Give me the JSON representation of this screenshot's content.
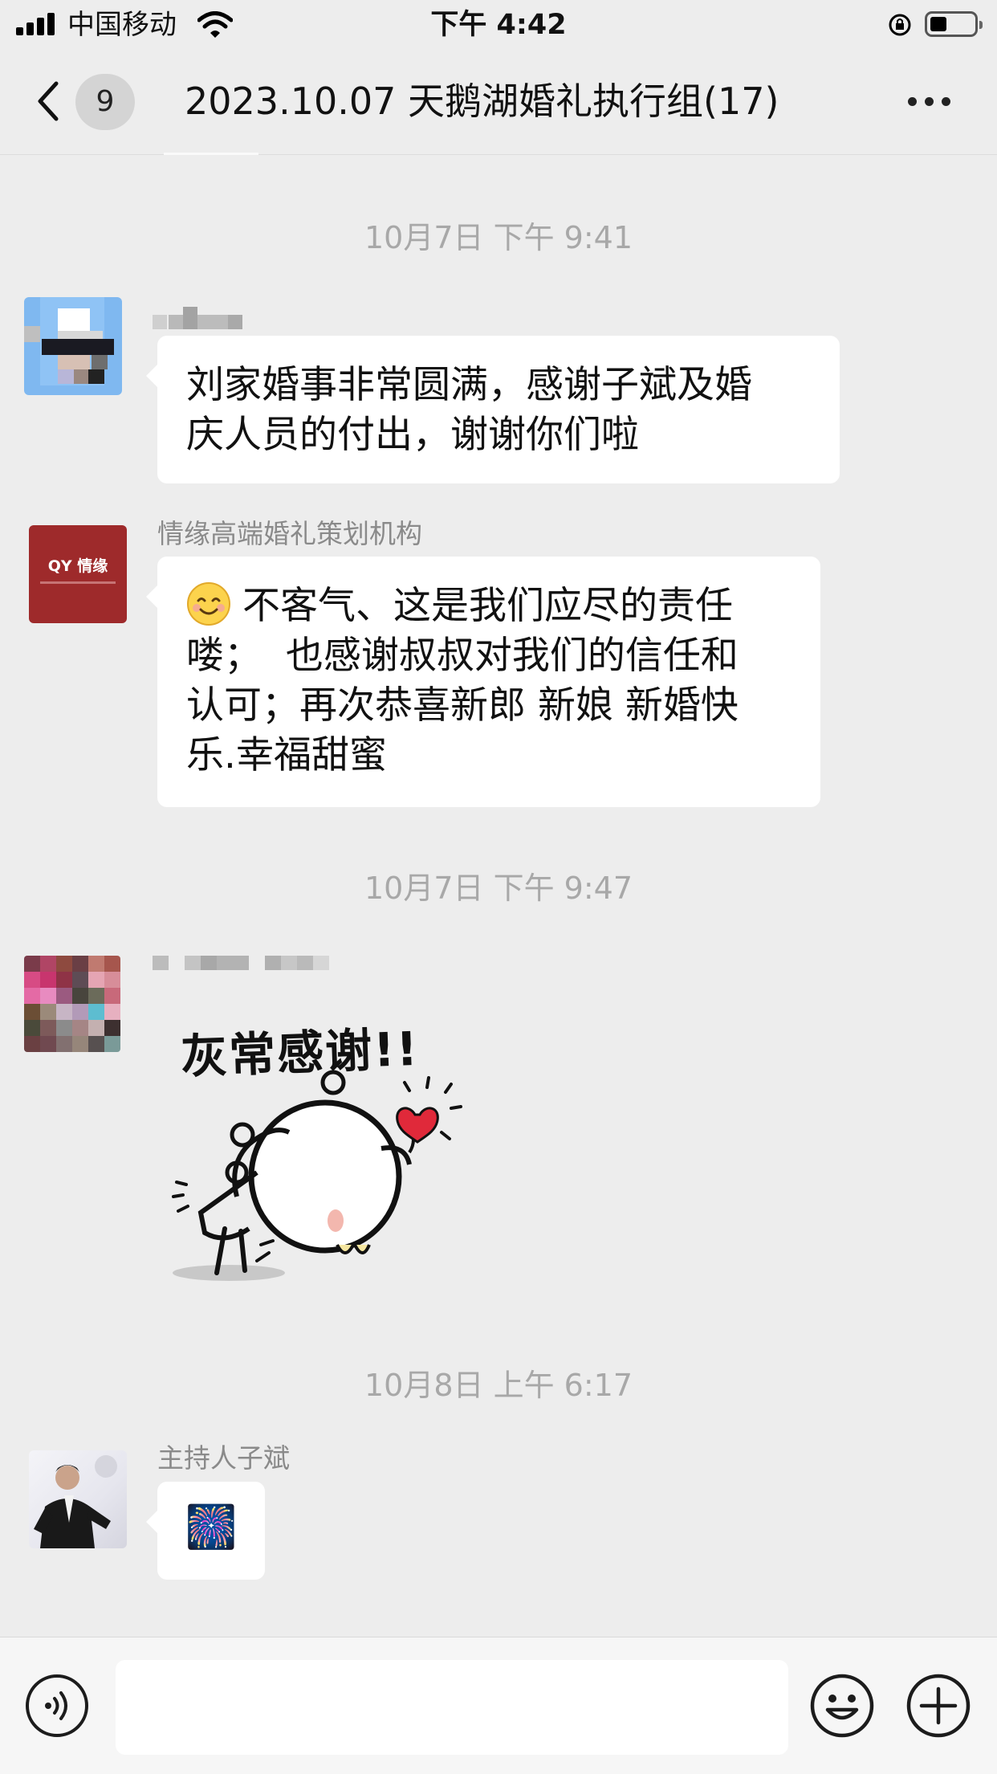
{
  "status_bar": {
    "carrier": "中国移动",
    "time": "下午 4:42"
  },
  "nav": {
    "unread_count": "9",
    "title": "2023.10.07 天鹅湖婚礼执行组(17)"
  },
  "messages": [
    {
      "timestamp": "10月7日 下午 9:41",
      "sender": "",
      "text_lines": [
        "刘家婚事非常圆满，感谢子斌及婚",
        "庆人员的付出，谢谢你们啦"
      ]
    },
    {
      "sender": "情缘高端婚礼策划机构",
      "avatar_brand": "QY 情缘",
      "text_lines": [
        "不客气、这是我们应尽的责任",
        "喽；  也感谢叔叔对我们的信任和",
        "认可；再次恭喜新郎 新娘 新婚快",
        "乐.幸福甜蜜"
      ]
    },
    {
      "timestamp": "10月7日 下午 9:47",
      "sender": "",
      "sticker_text": "灰常感谢!!"
    },
    {
      "timestamp": "10月8日 上午 6:17",
      "sender": "主持人子斌",
      "emoji": "🎆"
    }
  ],
  "icons": {
    "back": "chevron-left-icon",
    "more": "ellipsis-icon",
    "voice": "voice-icon",
    "emoji": "smiley-icon",
    "plus": "plus-icon"
  },
  "colors": {
    "background": "#ededed",
    "bubble": "#ffffff",
    "timestamp": "#a8a8a8",
    "brand_avatar": "#9e2a2b"
  }
}
